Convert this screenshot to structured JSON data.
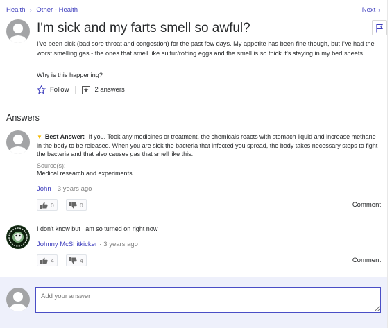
{
  "breadcrumb": {
    "items": [
      "Health",
      "Other - Health"
    ]
  },
  "nav": {
    "next_label": "Next"
  },
  "question": {
    "title": "I'm sick and my farts smell so awful?",
    "body": "I've been sick (bad sore throat and congestion) for the past few days. My appetite has been fine though, but I've had the worst smelling gas - the ones that smell like sulfur/rotting eggs and the smell is so thick it's staying in my bed sheets.",
    "why": "Why is this happening?",
    "follow_label": "Follow",
    "answers_count_label": "2 answers"
  },
  "answers_heading": "Answers",
  "answers": [
    {
      "best_label": "Best Answer:",
      "text": "If you. Took any medicines or treatment, the chemicals reacts with stomach liquid and increase methane in the body to be released. When you are sick the bacteria that infected you spread, the body takes necessary steps to fight the bacteria and that also causes gas that smell like this.",
      "source_label": "Source(s):",
      "source_text": "Medical research and experiments",
      "author": "John",
      "time": "3 years ago",
      "upvotes": "0",
      "downvotes": "0",
      "comment_label": "Comment"
    },
    {
      "text": "I don't know but I am so turned on right now",
      "author": "Johnny McShitkicker",
      "time": "3 years ago",
      "upvotes": "4",
      "downvotes": "4",
      "comment_label": "Comment"
    }
  ],
  "compose": {
    "placeholder": "Add your answer"
  },
  "icons": {
    "breadcrumb_separator": "chevron-right-icon",
    "flag": "flag-icon",
    "follow": "star-icon",
    "answers": "answers-icon",
    "best_answer": "trophy-icon",
    "thumbs_up": "thumbs-up-icon",
    "thumbs_down": "thumbs-down-icon"
  },
  "colors": {
    "link": "#3d3dbd",
    "muted": "#828282",
    "compose_bg": "#eef0fb",
    "input_border": "#4a4ec6",
    "trophy": "#f5b800"
  }
}
